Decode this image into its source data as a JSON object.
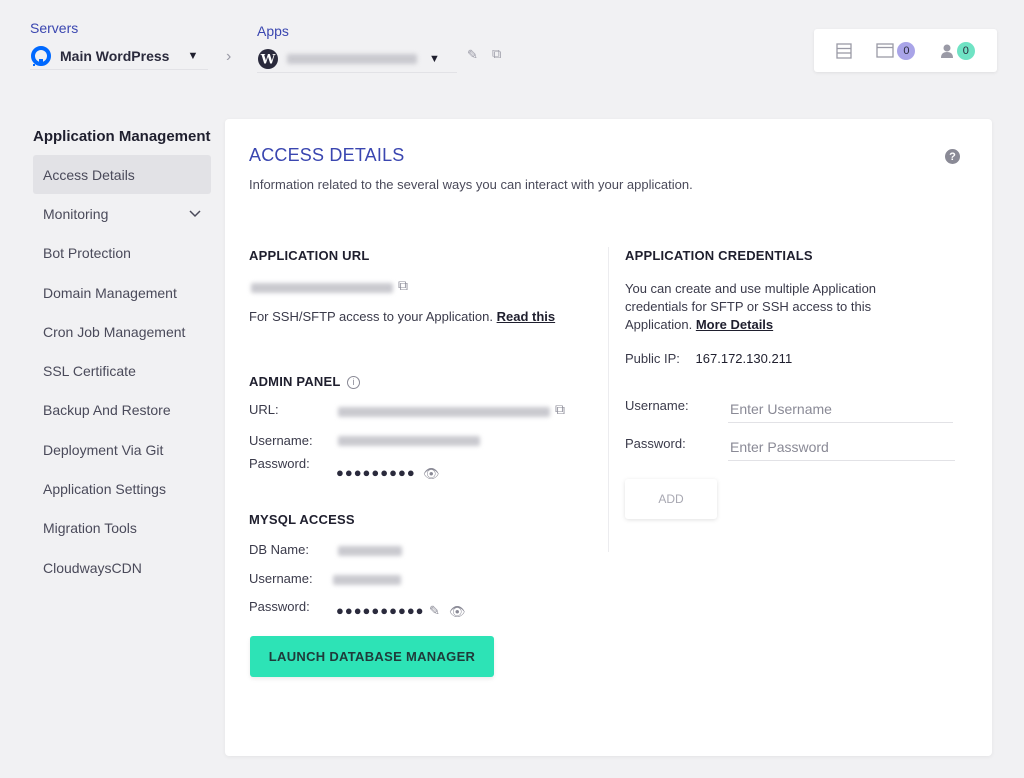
{
  "breadcrumb": {
    "servers_label": "Servers",
    "server_name": "Main WordPress",
    "apps_label": "Apps"
  },
  "top_widget": {
    "files_count": "0",
    "users_count": "0"
  },
  "sidebar": {
    "title": "Application Management",
    "items": [
      {
        "label": "Access Details"
      },
      {
        "label": "Monitoring"
      },
      {
        "label": "Bot Protection"
      },
      {
        "label": "Domain Management"
      },
      {
        "label": "Cron Job Management"
      },
      {
        "label": "SSL Certificate"
      },
      {
        "label": "Backup And Restore"
      },
      {
        "label": "Deployment Via Git"
      },
      {
        "label": "Application Settings"
      },
      {
        "label": "Migration Tools"
      },
      {
        "label": "CloudwaysCDN"
      }
    ]
  },
  "main": {
    "title": "ACCESS DETAILS",
    "subtitle": "Information related to the several ways you can interact with your application.",
    "app_url": {
      "title": "APPLICATION URL",
      "ssh_text": "For SSH/SFTP access to your Application.",
      "read_this": "Read this"
    },
    "admin_panel": {
      "title": "ADMIN PANEL",
      "url_label": "URL:",
      "username_label": "Username:",
      "password_label": "Password:",
      "password_mask": "●●●●●●●●●"
    },
    "mysql": {
      "title": "MYSQL ACCESS",
      "db_label": "DB Name:",
      "username_label": "Username:",
      "password_label": "Password:",
      "password_mask": "●●●●●●●●●●"
    },
    "credentials": {
      "title": "APPLICATION CREDENTIALS",
      "desc": "You can create and use multiple Application credentials for SFTP or SSH access to this Application.",
      "more_details": "More Details",
      "public_ip_label": "Public IP:",
      "public_ip": "167.172.130.211",
      "username_label": "Username:",
      "username_placeholder": "Enter Username",
      "password_label": "Password:",
      "password_placeholder": "Enter Password",
      "add_label": "ADD"
    },
    "launch_label": "LAUNCH DATABASE MANAGER"
  }
}
